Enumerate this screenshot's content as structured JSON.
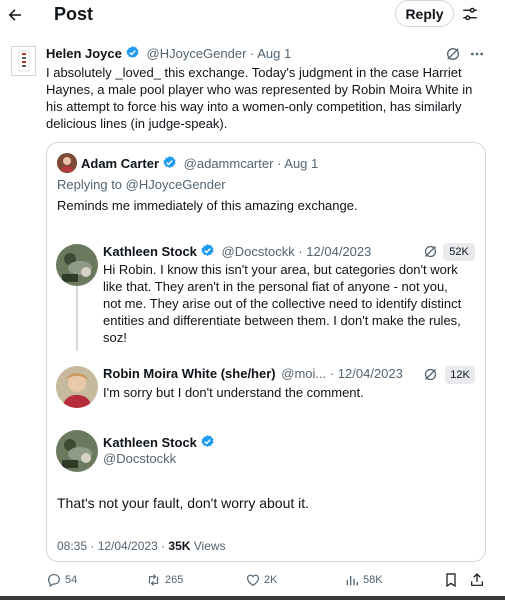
{
  "header": {
    "title": "Post",
    "reply_label": "Reply"
  },
  "post": {
    "author_name": "Helen Joyce",
    "author_handle": "@HJoyceGender",
    "date": "· Aug 1",
    "text": "I absolutely _loved_ this exchange. Today's judgment in the case Harriet Haynes, a male pool player who was represented by Robin Moira White in his attempt to force his way into a women-only competition, has similarly delicious lines (in judge-speak)."
  },
  "quote": {
    "author_name": "Adam Carter",
    "author_handle": "@adammcarter",
    "date": "· Aug 1",
    "replying_prefix": "Replying to ",
    "replying_handle": "@HJoyceGender",
    "text": "Reminds me immediately of this amazing exchange.",
    "thread": {
      "msg1": {
        "author_name": "Kathleen Stock",
        "author_handle": "@Docstockk",
        "date": "· 12/04/2023",
        "views": "52K",
        "text": "Hi Robin. I know this isn't your area, but categories don't work like that. They aren't in the personal fiat of anyone - not you, not me. They arise out of the collective need to identify distinct entities and differentiate between them. I don't make the rules, soz!"
      },
      "msg2": {
        "author_name": "Robin Moira White (she/her)",
        "author_handle": "@moi...",
        "date": "· 12/04/2023",
        "views": "12K",
        "text": "I'm sorry but I don't understand the comment."
      },
      "msg3": {
        "author_name": "Kathleen Stock",
        "author_handle": "@Docstockk",
        "text": "That's not your fault, don't worry about it.",
        "time": "08:35 · 12/04/2023 · ",
        "views_count": "35K",
        "views_label": " Views"
      }
    }
  },
  "actions": {
    "replies": "54",
    "reposts": "265",
    "likes": "2K",
    "views": "58K"
  },
  "colors": {
    "accent": "#1d9bf0",
    "text": "#0f1419",
    "secondary": "#536471",
    "border": "#cfd9de"
  },
  "icons": [
    "back-arrow-icon",
    "filter-sliders-icon",
    "verified-badge-icon",
    "grok-icon",
    "more-icon",
    "views-icon",
    "reply-icon",
    "repost-icon",
    "like-icon",
    "bookmark-icon",
    "share-icon"
  ]
}
